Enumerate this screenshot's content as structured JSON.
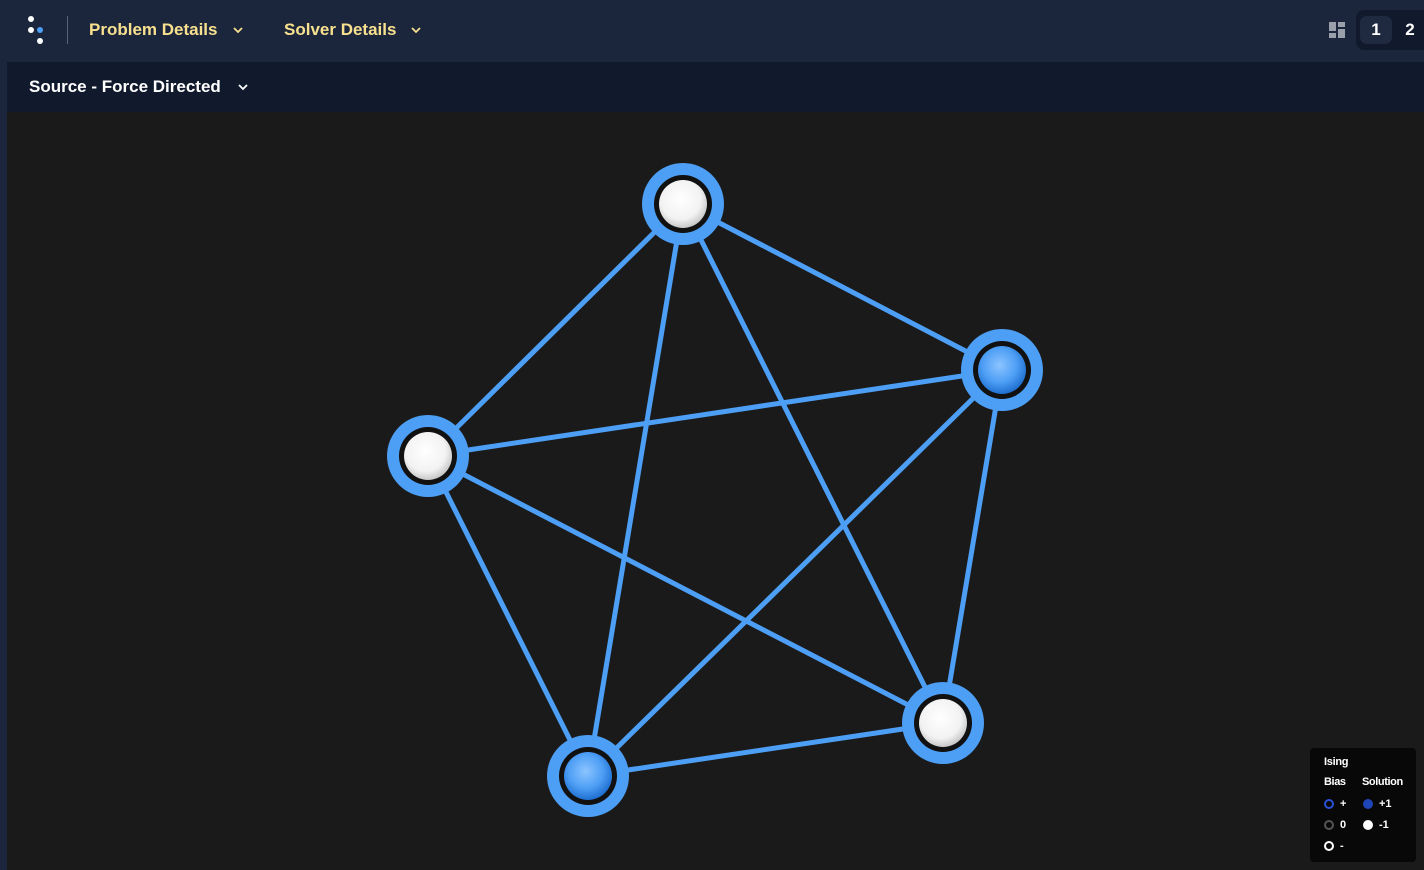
{
  "header": {
    "menus": [
      {
        "label": "Problem Details"
      },
      {
        "label": "Solver Details"
      }
    ],
    "pages": [
      "1",
      "2"
    ],
    "active_page": "1",
    "accent_color": "#f7e08e"
  },
  "view": {
    "selected": "Source - Force Directed"
  },
  "graph": {
    "edge_color": "#4d9ef5",
    "nodes": [
      {
        "name": "node-top",
        "solution": -1
      },
      {
        "name": "node-right",
        "solution": 1
      },
      {
        "name": "node-left",
        "solution": -1
      },
      {
        "name": "node-bottom-left",
        "solution": 1
      },
      {
        "name": "node-bottom-right",
        "solution": -1
      }
    ],
    "edges": [
      [
        0,
        1
      ],
      [
        0,
        2
      ],
      [
        0,
        3
      ],
      [
        0,
        4
      ],
      [
        1,
        2
      ],
      [
        1,
        3
      ],
      [
        1,
        4
      ],
      [
        2,
        3
      ],
      [
        2,
        4
      ],
      [
        3,
        4
      ]
    ]
  },
  "legend": {
    "title": "Ising",
    "bias_header": "Bias",
    "solution_header": "Solution",
    "bias": [
      {
        "label": "+",
        "color": "#2a4fd6"
      },
      {
        "label": "0",
        "color": "#555555"
      },
      {
        "label": "-",
        "color": "#ffffff"
      }
    ],
    "solution": [
      {
        "label": "+1",
        "color": "#1f46b8"
      },
      {
        "label": "-1",
        "color": "#ffffff"
      }
    ]
  }
}
